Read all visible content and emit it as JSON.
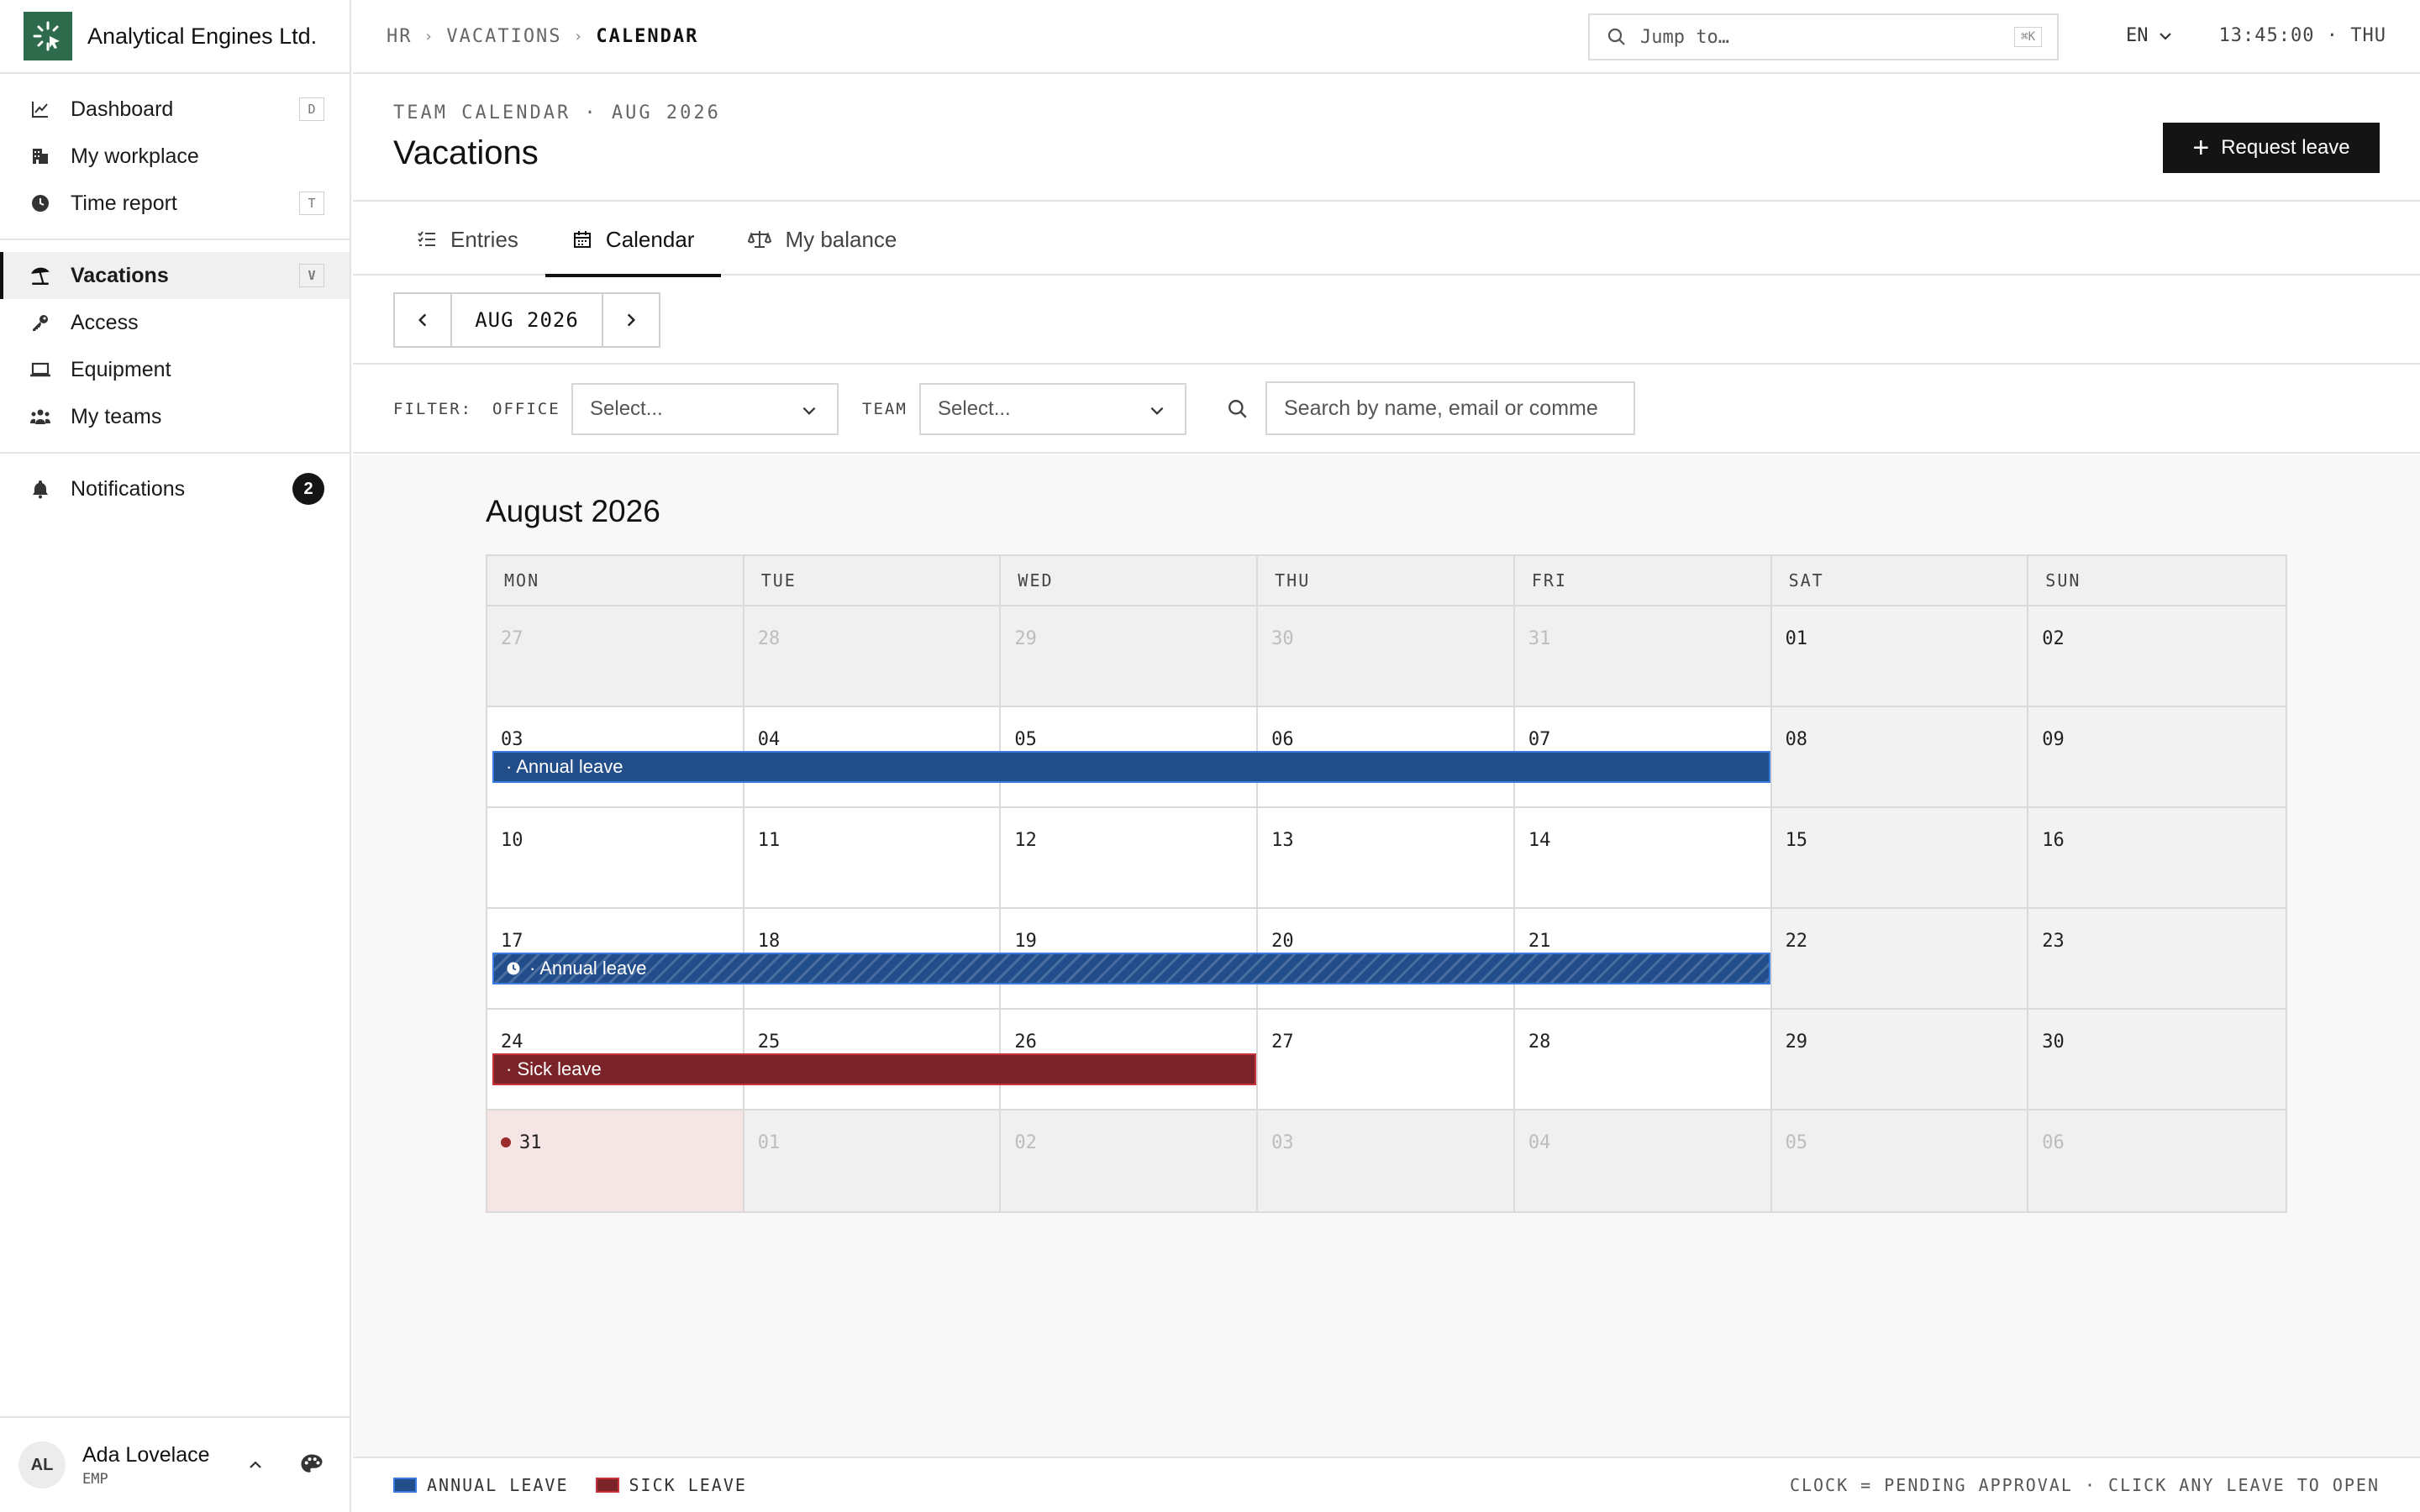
{
  "brand": {
    "name": "Analytical Engines Ltd.",
    "color": "#2e6a4c"
  },
  "sidebar": {
    "primary": [
      {
        "label": "Dashboard",
        "icon": "chart-line-icon",
        "key": "D"
      },
      {
        "label": "My workplace",
        "icon": "building-icon",
        "key": ""
      },
      {
        "label": "Time report",
        "icon": "clock-icon",
        "key": "T"
      }
    ],
    "secondary": [
      {
        "label": "Vacations",
        "icon": "umbrella-beach-icon",
        "key": "V",
        "active": true
      },
      {
        "label": "Access",
        "icon": "key-icon",
        "key": ""
      },
      {
        "label": "Equipment",
        "icon": "laptop-icon",
        "key": ""
      },
      {
        "label": "My teams",
        "icon": "users-icon",
        "key": ""
      }
    ],
    "notifications": {
      "label": "Notifications",
      "icon": "bell-icon",
      "count": "2"
    }
  },
  "user": {
    "initials": "AL",
    "name": "Ada Lovelace",
    "role": "EMP"
  },
  "topbar": {
    "breadcrumbs": [
      "HR",
      "VACATIONS",
      "CALENDAR"
    ],
    "jump_placeholder": "Jump to…",
    "jump_shortcut": "⌘K",
    "language": "EN",
    "clock": "13:45:00 · THU"
  },
  "header": {
    "eyebrow": "TEAM CALENDAR · AUG 2026",
    "title": "Vacations",
    "request_button": "Request leave"
  },
  "tabs": [
    {
      "label": "Entries",
      "icon": "list-check-icon",
      "active": false
    },
    {
      "label": "Calendar",
      "icon": "calendar-icon",
      "active": true
    },
    {
      "label": "My balance",
      "icon": "scale-balance-icon",
      "active": false
    }
  ],
  "month_nav": {
    "label": "AUG 2026"
  },
  "filters": {
    "filter_label": "FILTER:",
    "office_label": "OFFICE",
    "office_value": "Select...",
    "team_label": "TEAM",
    "team_value": "Select...",
    "search_placeholder": "Search by name, email or comme"
  },
  "calendar": {
    "title": "August 2026",
    "weekdays": [
      "MON",
      "TUE",
      "WED",
      "THU",
      "FRI",
      "SAT",
      "SUN"
    ],
    "weeks": [
      {
        "days": [
          "27",
          "28",
          "29",
          "30",
          "31",
          "01",
          "02"
        ],
        "outside": [
          0,
          1,
          2,
          3,
          4
        ]
      },
      {
        "days": [
          "03",
          "04",
          "05",
          "06",
          "07",
          "08",
          "09"
        ],
        "outside": []
      },
      {
        "days": [
          "10",
          "11",
          "12",
          "13",
          "14",
          "15",
          "16"
        ],
        "outside": []
      },
      {
        "days": [
          "17",
          "18",
          "19",
          "20",
          "21",
          "22",
          "23"
        ],
        "outside": []
      },
      {
        "days": [
          "24",
          "25",
          "26",
          "27",
          "28",
          "29",
          "30"
        ],
        "outside": []
      },
      {
        "days": [
          "31",
          "01",
          "02",
          "03",
          "04",
          "05",
          "06"
        ],
        "outside": [
          1,
          2,
          3,
          4,
          5,
          6
        ],
        "today": 0
      }
    ],
    "leaves": [
      {
        "week": 1,
        "start_col": 0,
        "span": 5,
        "label": "· Annual leave",
        "type": "annual",
        "pending": false
      },
      {
        "week": 3,
        "start_col": 0,
        "span": 5,
        "label": "· Annual leave",
        "type": "annual",
        "pending": true
      },
      {
        "week": 4,
        "start_col": 0,
        "span": 3,
        "label": "· Sick leave",
        "type": "sick",
        "pending": false
      }
    ]
  },
  "legend": {
    "items": [
      {
        "label": "ANNUAL LEAVE",
        "type": "annual",
        "color": "#214d8a"
      },
      {
        "label": "SICK LEAVE",
        "type": "sick",
        "color": "#7a2328"
      }
    ],
    "hint": "CLOCK = PENDING APPROVAL · CLICK ANY LEAVE TO OPEN"
  }
}
